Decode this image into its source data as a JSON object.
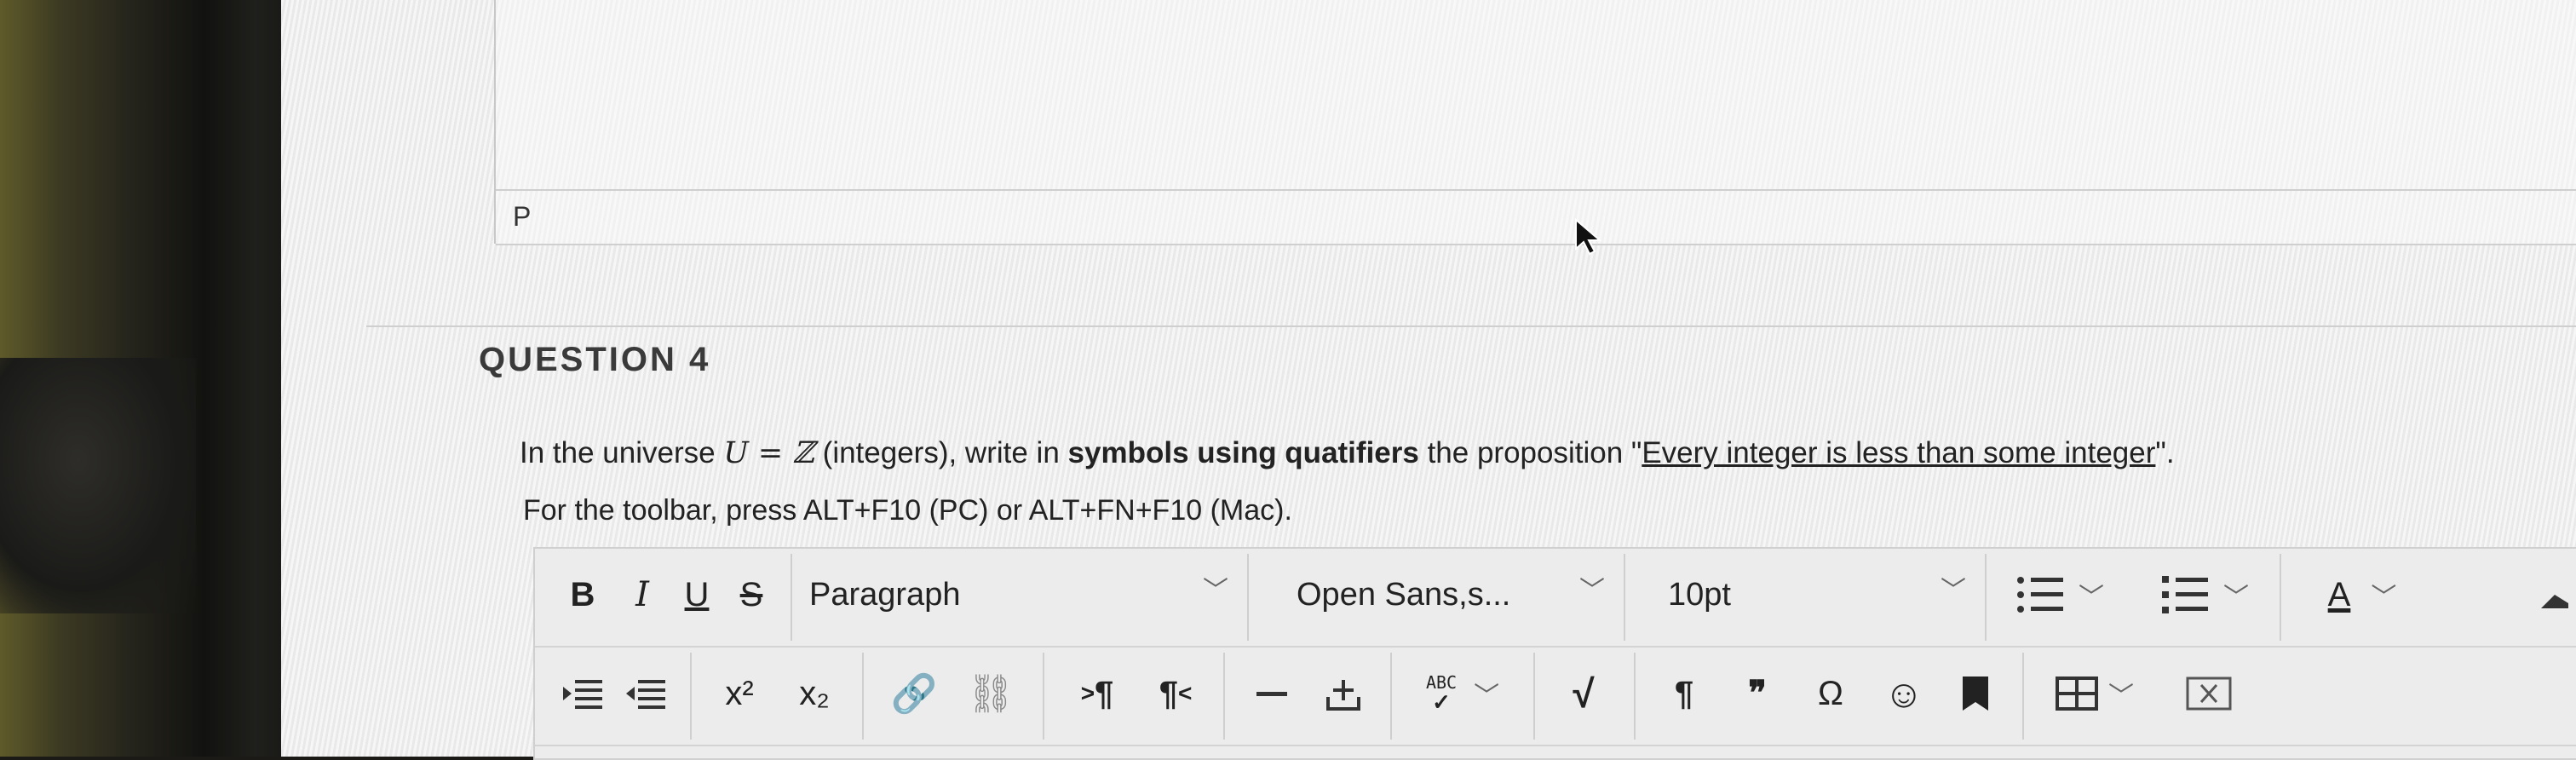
{
  "previous_editor": {
    "status_path": "P"
  },
  "question": {
    "title": "QUESTION 4",
    "text_parts": {
      "p1": "In the universe ",
      "math": "U = ℤ",
      "p2": " (integers), write in ",
      "bold": "symbols using quatifiers",
      "p3": "  the proposition \"",
      "underlined": "Every integer is less than some integer",
      "p4": "\"."
    },
    "toolbar_hint": "For the toolbar, press ALT+F10 (PC) or ALT+FN+F10 (Mac)."
  },
  "toolbar": {
    "bold": "B",
    "italic": "I",
    "underline": "U",
    "strike": "S",
    "paragraph": "Paragraph",
    "font_family": "Open Sans,s...",
    "font_size": "10pt",
    "text_color_label": "A",
    "superscript": "x²",
    "subscript": "x₂",
    "ltr": "¶",
    "rtl": "¶",
    "spellcheck": "ABC",
    "pilcrow": "¶",
    "quote": "❞",
    "omega": "Ω"
  },
  "colors": {
    "text": "#222222",
    "toolbar_bg": "#ececec",
    "border": "#cfcfcf"
  }
}
